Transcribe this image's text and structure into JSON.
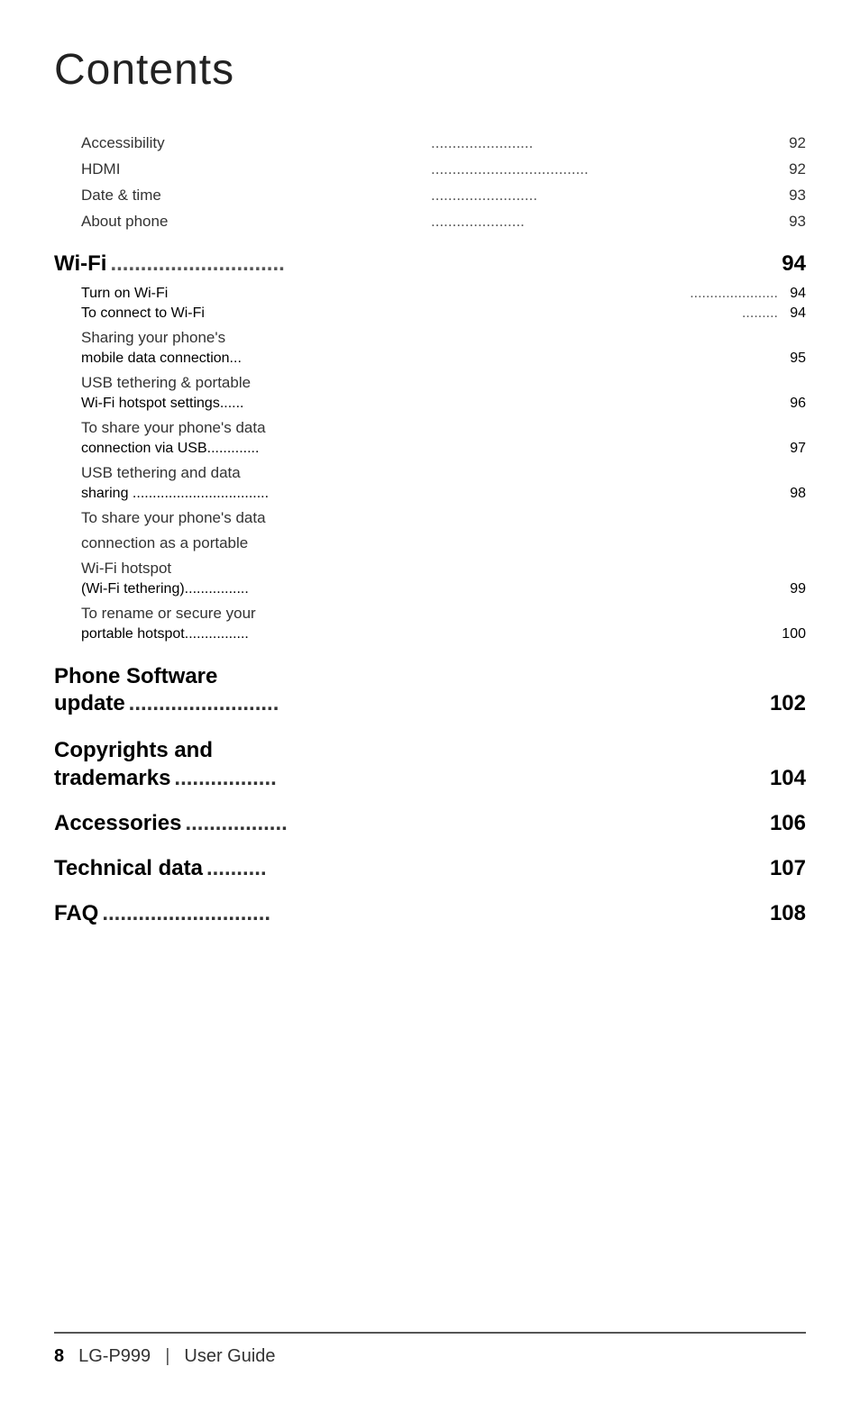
{
  "page": {
    "title": "Contents",
    "footer": {
      "page_number": "8",
      "separator": "LG-P999",
      "guide_text": "User Guide"
    }
  },
  "toc": {
    "intro_items": [
      {
        "label": "Accessibility",
        "dots": "........................",
        "page": "92"
      },
      {
        "label": "HDMI",
        "dots": ".....................................",
        "page": "92"
      },
      {
        "label": "Date & time",
        "dots": ".........................",
        "page": "93"
      },
      {
        "label": "About phone",
        "dots": "......................",
        "page": "93"
      }
    ],
    "wifi_section": {
      "heading": "Wi-Fi",
      "heading_dots": ".............................",
      "heading_page": "94",
      "items": [
        {
          "line1": "Turn on Wi-Fi",
          "dots": "......................",
          "page": "94",
          "multiline": false
        },
        {
          "line1": "To connect to Wi-Fi",
          "dots": ".........",
          "page": "94",
          "multiline": false
        },
        {
          "line1": "Sharing your phone's",
          "line2": "mobile data connection...",
          "page": "95",
          "multiline": true
        },
        {
          "line1": "USB tethering & portable",
          "line2": "Wi-Fi hotspot settings......",
          "page": "96",
          "multiline": true
        },
        {
          "line1": "To share your phone's data",
          "line2": "connection via USB.............",
          "page": "97",
          "multiline": true
        },
        {
          "line1": "USB tethering and data",
          "line2": "sharing ..................................",
          "page": "98",
          "multiline": true
        },
        {
          "line1": "To share your phone's data",
          "line2": "connection as a portable",
          "line3": "Wi-Fi hotspot",
          "line4": "(Wi-Fi tethering)................",
          "page": "99",
          "multiline": true,
          "fourline": true
        },
        {
          "line1": "To rename or secure your",
          "line2": "portable hotspot................",
          "page": "100",
          "multiline": true
        }
      ]
    },
    "phone_software_section": {
      "heading_line1": "Phone Software",
      "heading_line2_label": "update",
      "heading_dots": ".........................",
      "heading_page": "102"
    },
    "copyrights_section": {
      "heading_line1": "Copyrights and",
      "heading_line2_label": "trademarks",
      "heading_dots": " .................",
      "heading_page": "104"
    },
    "accessories_section": {
      "heading_label": "Accessories",
      "heading_dots": " .................",
      "heading_page": "106"
    },
    "technical_section": {
      "heading_label": "Technical data",
      "heading_dots": " ..........",
      "heading_page": "107"
    },
    "faq_section": {
      "heading_label": "FAQ",
      "heading_dots": " ............................",
      "heading_page": "108"
    }
  }
}
